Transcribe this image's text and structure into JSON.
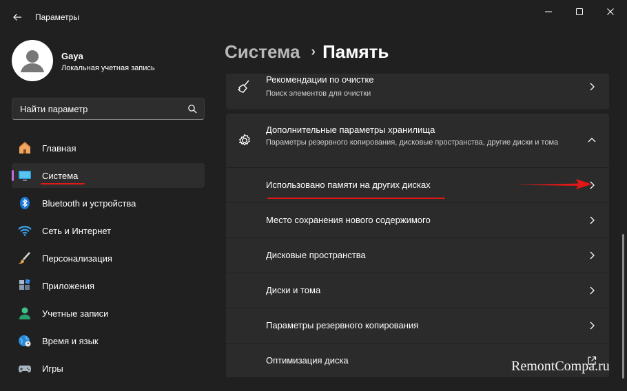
{
  "window": {
    "title": "Параметры",
    "controls": {
      "minimize": "minimize-icon",
      "maximize": "maximize-icon",
      "close": "close-icon"
    }
  },
  "profile": {
    "name": "Gaya",
    "account_type": "Локальная учетная запись"
  },
  "search": {
    "placeholder": "Найти параметр"
  },
  "sidebar": {
    "items": [
      {
        "label": "Главная",
        "icon": "home-icon",
        "active": false
      },
      {
        "label": "Система",
        "icon": "monitor-icon",
        "active": true
      },
      {
        "label": "Bluetooth и устройства",
        "icon": "bluetooth-icon",
        "active": false
      },
      {
        "label": "Сеть и Интернет",
        "icon": "wifi-icon",
        "active": false
      },
      {
        "label": "Персонализация",
        "icon": "brush-icon",
        "active": false
      },
      {
        "label": "Приложения",
        "icon": "apps-icon",
        "active": false
      },
      {
        "label": "Учетные записи",
        "icon": "person-icon",
        "active": false
      },
      {
        "label": "Время и язык",
        "icon": "globe-clock-icon",
        "active": false
      },
      {
        "label": "Игры",
        "icon": "gamepad-icon",
        "active": false
      }
    ]
  },
  "breadcrumb": {
    "parent": "Система",
    "separator": "›",
    "current": "Память"
  },
  "cards": {
    "cleanup": {
      "title": "Рекомендации по очистке",
      "subtitle": "Поиск элементов для очистки"
    },
    "advanced": {
      "title": "Дополнительные параметры хранилища",
      "subtitle": "Параметры резервного копирования, дисковые пространства, другие диски и тома"
    }
  },
  "advanced_items": [
    {
      "label": "Использовано памяти на других дисках",
      "icon": "chevron-right-icon"
    },
    {
      "label": "Место сохранения нового содержимого",
      "icon": "chevron-right-icon"
    },
    {
      "label": "Дисковые пространства",
      "icon": "chevron-right-icon"
    },
    {
      "label": "Диски и тома",
      "icon": "chevron-right-icon"
    },
    {
      "label": "Параметры резервного копирования",
      "icon": "chevron-right-icon"
    },
    {
      "label": "Оптимизация диска",
      "icon": "external-link-icon"
    }
  ],
  "watermark": "RemontCompa.ru",
  "colors": {
    "background": "#202020",
    "card": "#2b2b2b",
    "accent": "#c76de0",
    "annotation_red": "#e01818"
  }
}
